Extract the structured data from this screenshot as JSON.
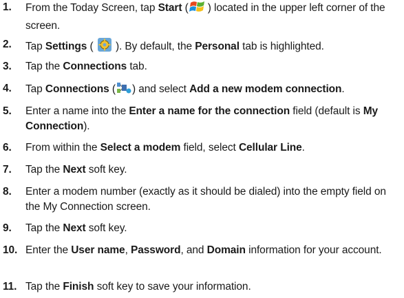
{
  "steps": [
    {
      "n": "1.",
      "segs": [
        {
          "t": "From the Today Screen, tap "
        },
        {
          "t": "Start",
          "b": true
        },
        {
          "t": " ("
        },
        {
          "icon": "windows-start-icon"
        },
        {
          "t": ") located in the upper left corner of the screen."
        }
      ]
    },
    {
      "n": "2.",
      "segs": [
        {
          "t": "Tap "
        },
        {
          "t": "Settings",
          "b": true
        },
        {
          "t": " ( "
        },
        {
          "icon": "settings-gear-icon"
        },
        {
          "t": " ). By default, the "
        },
        {
          "t": "Personal",
          "b": true
        },
        {
          "t": " tab is highlighted."
        }
      ]
    },
    {
      "n": "3.",
      "segs": [
        {
          "t": "Tap the "
        },
        {
          "t": "Connections",
          "b": true
        },
        {
          "t": " tab."
        }
      ]
    },
    {
      "n": "4.",
      "segs": [
        {
          "t": "Tap "
        },
        {
          "t": "Connections",
          "b": true
        },
        {
          "t": " ("
        },
        {
          "icon": "connections-network-icon"
        },
        {
          "t": ") and select "
        },
        {
          "t": "Add a new modem connection",
          "b": true
        },
        {
          "t": "."
        }
      ]
    },
    {
      "n": "5.",
      "segs": [
        {
          "t": "Enter a name into the "
        },
        {
          "t": "Enter a name for the connection",
          "b": true
        },
        {
          "t": " field (default is "
        },
        {
          "t": "My Connection",
          "b": true
        },
        {
          "t": ")."
        }
      ]
    },
    {
      "n": "6.",
      "segs": [
        {
          "t": "From within the "
        },
        {
          "t": "Select a modem",
          "b": true
        },
        {
          "t": " field, select "
        },
        {
          "t": "Cellular Line",
          "b": true
        },
        {
          "t": "."
        }
      ]
    },
    {
      "n": "7.",
      "segs": [
        {
          "t": "Tap the "
        },
        {
          "t": "Next",
          "b": true
        },
        {
          "t": " soft key."
        }
      ]
    },
    {
      "n": "8.",
      "segs": [
        {
          "t": "Enter a modem number (exactly as it should be dialed) into the empty field on the My Connection screen."
        }
      ]
    },
    {
      "n": "9.",
      "segs": [
        {
          "t": "Tap the "
        },
        {
          "t": "Next",
          "b": true
        },
        {
          "t": " soft key."
        }
      ]
    },
    {
      "n": "10.",
      "segs": [
        {
          "t": "Enter the "
        },
        {
          "t": "User name",
          "b": true
        },
        {
          "t": ", "
        },
        {
          "t": "Password",
          "b": true
        },
        {
          "t": ", and "
        },
        {
          "t": "Domain",
          "b": true
        },
        {
          "t": " information for your account."
        }
      ]
    },
    {
      "n": "11.",
      "segs": [
        {
          "t": "Tap the "
        },
        {
          "t": "Finish",
          "b": true
        },
        {
          "t": " soft key to save your information."
        }
      ]
    }
  ]
}
